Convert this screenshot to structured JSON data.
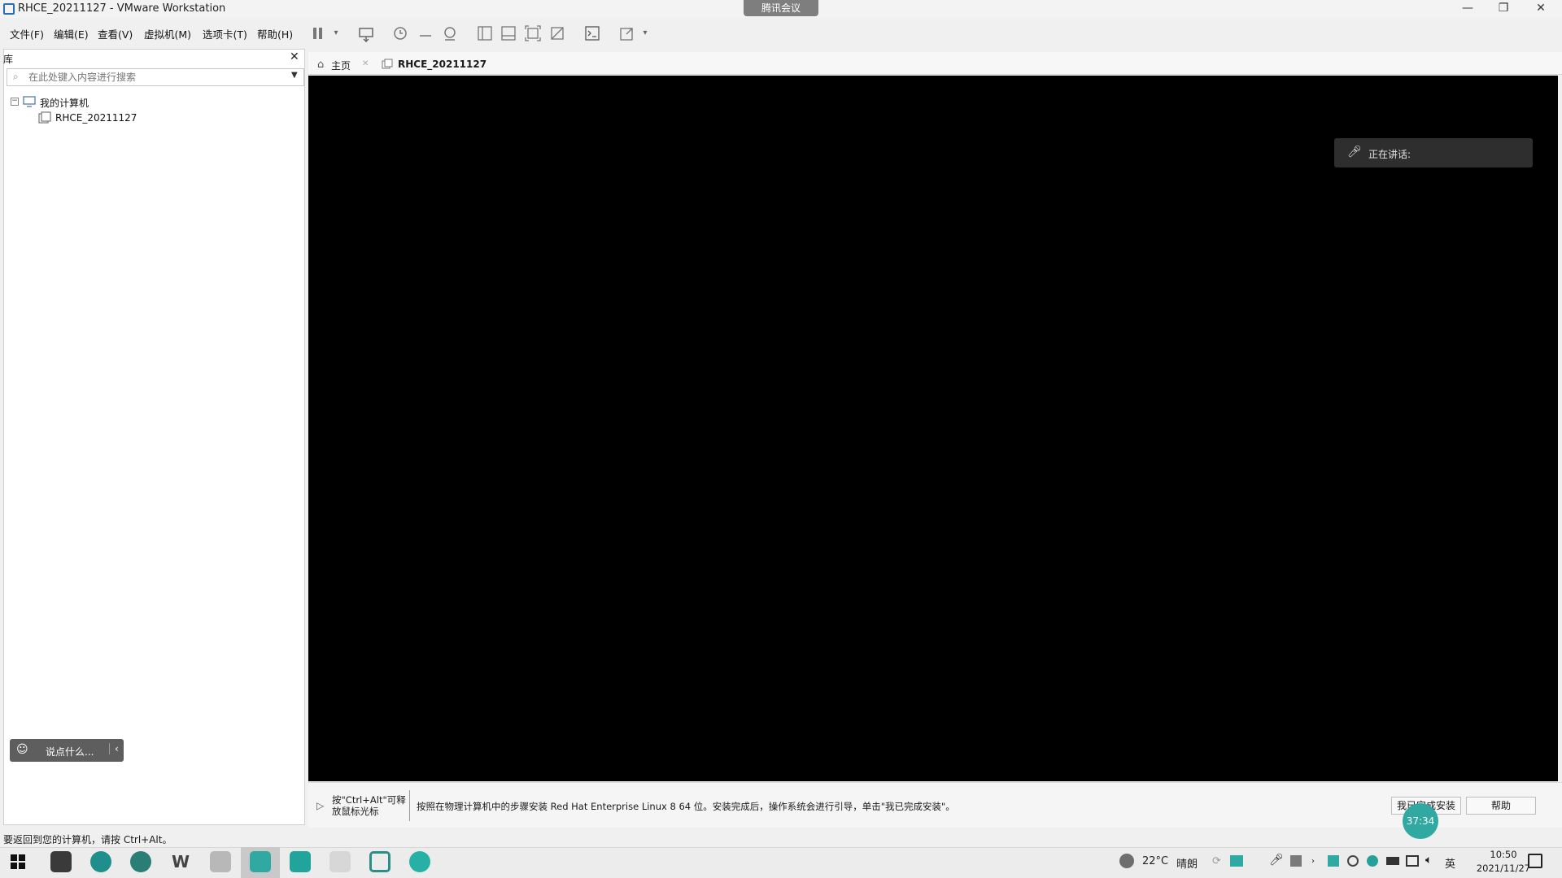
{
  "window": {
    "title": "RHCE_20211127 - VMware Workstation",
    "meeting_tag": "腾讯会议",
    "minimize": "—",
    "restore": "❐",
    "close": "✕"
  },
  "menu": {
    "items": [
      "文件(F)",
      "编辑(E)",
      "查看(V)",
      "虚拟机(M)",
      "选项卡(T)",
      "帮助(H)"
    ]
  },
  "library": {
    "header": "库",
    "close": "✕",
    "search_placeholder": "在此处键入内容进行搜索",
    "tree": {
      "root": "我的计算机",
      "child": "RHCE_20211127"
    }
  },
  "tabs": {
    "home": "主页",
    "vm": "RHCE_20211127"
  },
  "overlay": {
    "speaking": "正在讲话:"
  },
  "hint": {
    "mouse_release": "按\"Ctrl+Alt\"可释放鼠标光标",
    "message": "按照在物理计算机中的步骤安装 Red Hat Enterprise Linux 8 64 位。安装完成后，操作系统会进行引导，单击\"我已完成安装\"。",
    "finish_button": "我已完成安装",
    "help_button": "帮助"
  },
  "statusbar": {
    "text": "要返回到您的计算机，请按 Ctrl+Alt。"
  },
  "chat": {
    "placeholder": "说点什么..."
  },
  "timer": "37:34",
  "taskbar": {
    "weather_temp": "22°C",
    "weather_desc": "晴朗",
    "ime": "英",
    "time": "10:50",
    "date": "2021/11/27"
  },
  "colors": {
    "accent": "#2fa9a1",
    "vm_background": "#000000"
  }
}
